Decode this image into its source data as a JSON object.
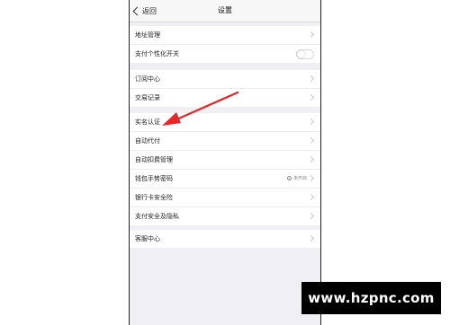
{
  "navbar": {
    "back_label": "返回",
    "title": "设置"
  },
  "groups": [
    {
      "rows": [
        {
          "label": "地址管理",
          "accessory": "chevron"
        },
        {
          "label": "支付个性化开关",
          "accessory": "toggle",
          "toggle_on": false
        }
      ]
    },
    {
      "rows": [
        {
          "label": "订阅中心",
          "accessory": "chevron"
        },
        {
          "label": "交易记录",
          "accessory": "chevron"
        }
      ]
    },
    {
      "rows": [
        {
          "label": "实名认证",
          "accessory": "chevron"
        },
        {
          "label": "自动代付",
          "accessory": "chevron"
        },
        {
          "label": "自动扣费管理",
          "accessory": "chevron"
        },
        {
          "label": "钱包手势密码",
          "accessory": "status",
          "status_text": "未开启"
        },
        {
          "label": "银行卡安全险",
          "accessory": "chevron"
        },
        {
          "label": "支付安全及隐私",
          "accessory": "chevron"
        }
      ]
    },
    {
      "rows": [
        {
          "label": "客服中心",
          "accessory": "chevron"
        }
      ]
    }
  ],
  "annotation": {
    "color": "#e8262a",
    "icon": "red-pointer-arrow"
  },
  "watermark": "www.hzpnc.com"
}
